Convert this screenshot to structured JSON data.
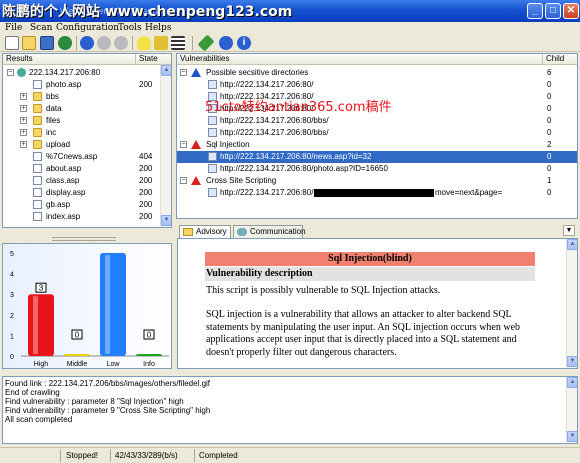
{
  "window": {
    "watermark": "陈鹏的个人网站 www.chenpeng123.com",
    "title": "Web Vulnerability Scanner",
    "minimize": "_",
    "maximize": "□",
    "close": "✕"
  },
  "menu": [
    "File",
    "Scan",
    "Configuration",
    "Tools",
    "Helps"
  ],
  "results": {
    "col_results": "Results",
    "col_state": "State",
    "root": "222.134.217.206:80",
    "items": [
      {
        "name": "photo.asp",
        "state": "200",
        "type": "page",
        "expand": false
      },
      {
        "name": "bbs",
        "state": "",
        "type": "folder",
        "expand": true
      },
      {
        "name": "data",
        "state": "",
        "type": "folder",
        "expand": true
      },
      {
        "name": "files",
        "state": "",
        "type": "folder",
        "expand": true
      },
      {
        "name": "inc",
        "state": "",
        "type": "folder",
        "expand": true
      },
      {
        "name": "upload",
        "state": "",
        "type": "folder",
        "expand": true
      },
      {
        "name": "%7Cnews.asp",
        "state": "404",
        "type": "page",
        "expand": false
      },
      {
        "name": "about.asp",
        "state": "200",
        "type": "page",
        "expand": false
      },
      {
        "name": "class.asp",
        "state": "200",
        "type": "page",
        "expand": false
      },
      {
        "name": "display.asp",
        "state": "200",
        "type": "page",
        "expand": false
      },
      {
        "name": "gb.asp",
        "state": "200",
        "type": "page",
        "expand": false
      },
      {
        "name": "index.asp",
        "state": "200",
        "type": "page",
        "expand": false
      }
    ]
  },
  "chart_data": {
    "type": "bar",
    "categories": [
      "High",
      "Middle",
      "Low",
      "Info"
    ],
    "values": [
      3,
      0,
      5,
      0
    ],
    "data_labels": [
      "3",
      "0",
      "",
      "0"
    ],
    "yticks": [
      "5",
      "4",
      "3",
      "2",
      "1",
      "0"
    ],
    "ylim": [
      0,
      5
    ],
    "colors": [
      "#e8141a",
      "#e8d000",
      "#1f7fff",
      "#1ea51e"
    ]
  },
  "vulns": {
    "col_vuln": "Vulnerabilities",
    "col_child": "Child",
    "rows": [
      {
        "text": "Possible secsitive directories",
        "child": "6",
        "level": 0,
        "icon": "warn-blue"
      },
      {
        "text": "http://222.134.217.206:80/",
        "child": "0",
        "level": 1,
        "icon": "page"
      },
      {
        "text": "http://222.134.217.206:80/",
        "child": "0",
        "level": 1,
        "icon": "page"
      },
      {
        "text": "http://222.134.217.206:80/",
        "child": "0",
        "level": 1,
        "icon": "page"
      },
      {
        "text": "http://222.134.217.206:80/bbs/",
        "child": "0",
        "level": 1,
        "icon": "page"
      },
      {
        "text": "http://222.134.217.206:80/bbs/",
        "child": "0",
        "level": 1,
        "icon": "page"
      },
      {
        "text": "Sql Injection",
        "child": "2",
        "level": 0,
        "icon": "warn-red"
      },
      {
        "text": "http://222.134.217.206:80/news.asp?id=32",
        "child": "0",
        "level": 1,
        "icon": "page",
        "selected": true
      },
      {
        "text": "http://222.134.217.206:80/photo.asp?ID=16650",
        "child": "0",
        "level": 1,
        "icon": "page"
      },
      {
        "text": "Cross Site Scripting",
        "child": "1",
        "level": 0,
        "icon": "warn-red"
      },
      {
        "text": "http://222.134.217.206:80/",
        "suffix": "move=next&page=",
        "child": "0",
        "level": 1,
        "icon": "page",
        "redacted": true
      }
    ],
    "overlay": "51cto特约antian365.com稿件"
  },
  "tabs": {
    "advisory": "Advisory",
    "communication": "Communication"
  },
  "advisory": {
    "banner": "Sql Injection(blind)",
    "heading": "Vulnerability description",
    "p1": "This script is possibly vulnerable to SQL Injection attacks.",
    "p2": "SQL injection is a vulnerability that allows an attacker to alter backend SQL statements by manipulating the user input. An SQL injection occurs when web applications accept user input that is directly placed into a SQL statement and doesn't properly filter out dangerous characters."
  },
  "log": [
    "Found link : 222.134.217.206/bbs/images/others/filedel.gif",
    "End of crawling",
    "Find vulnerability : parameter 8 \"Sql Injection\" high",
    "Find vulnerability : parameter 9 \"Cross Site Scripting\" high",
    "All scan completed"
  ],
  "status": {
    "state": "Stopped!",
    "speed": "42/43/33/289(b/s)",
    "progress": "Completed"
  }
}
